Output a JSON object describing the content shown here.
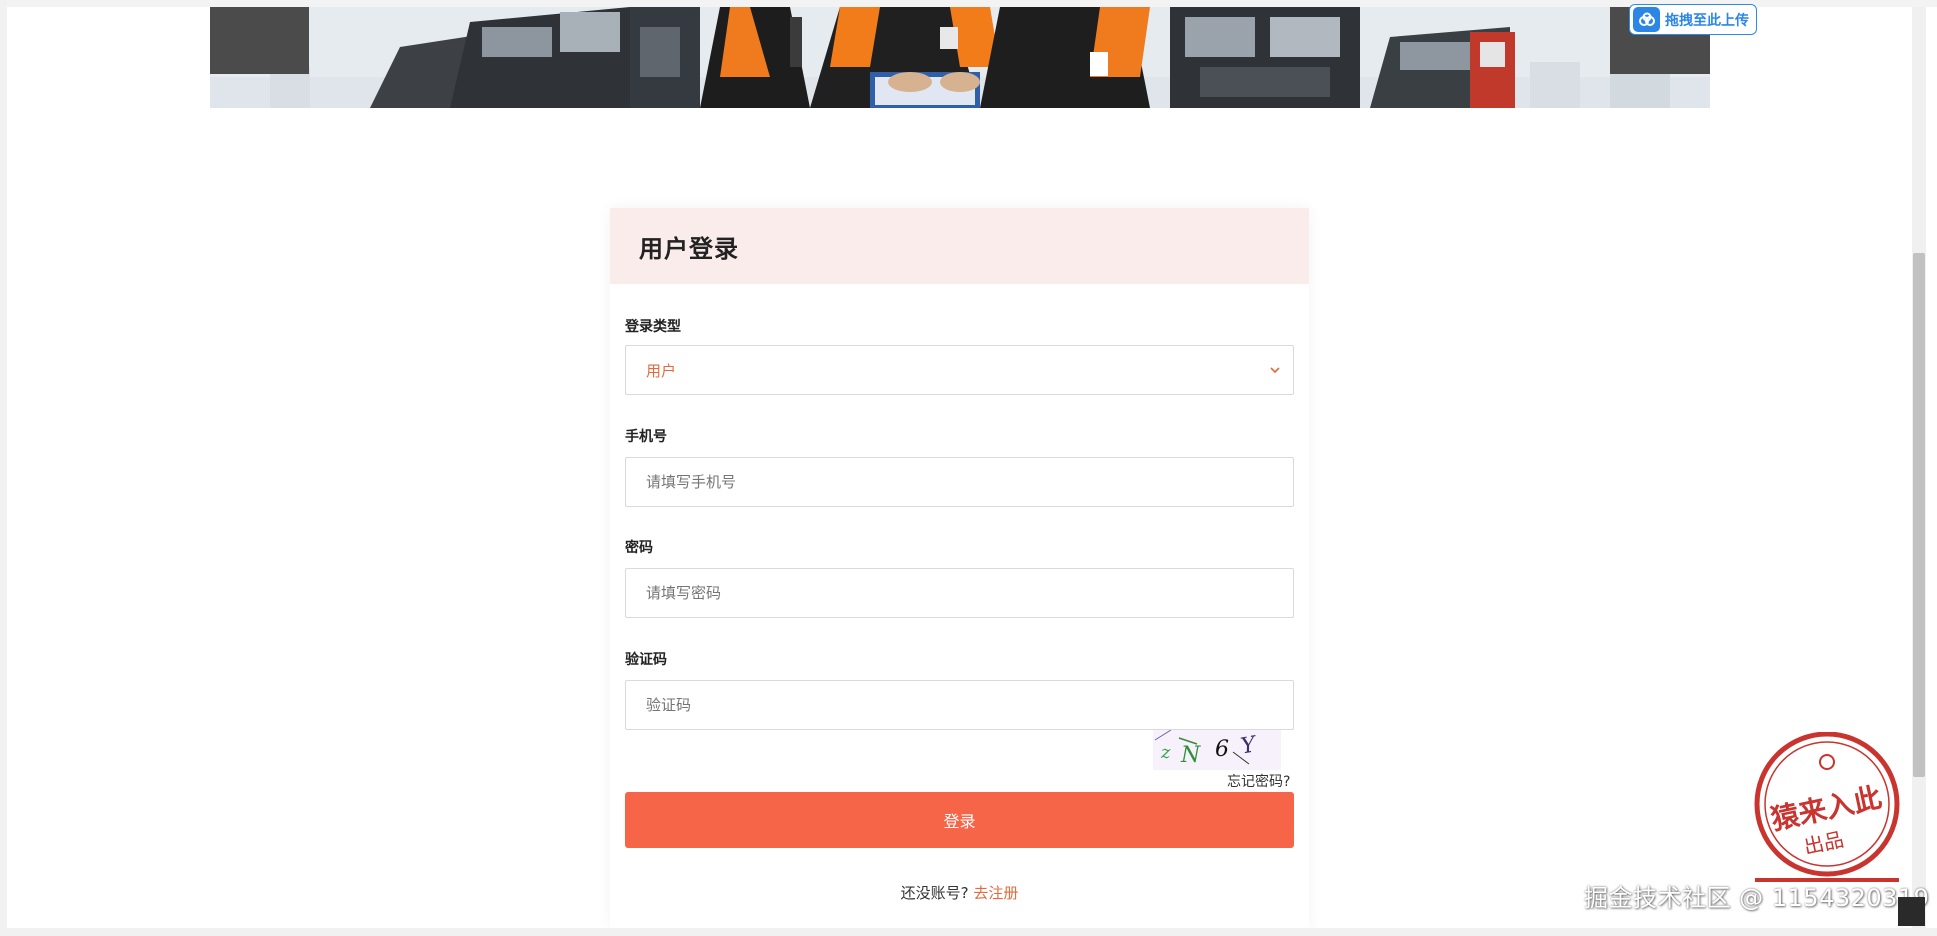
{
  "banner": {
    "upload_label": "拖拽至此上传"
  },
  "login": {
    "title": "用户登录",
    "type_label": "登录类型",
    "type_value": "用户",
    "phone_label": "手机号",
    "phone_placeholder": "请填写手机号",
    "password_label": "密码",
    "password_placeholder": "请填写密码",
    "captcha_label": "验证码",
    "captcha_placeholder": "验证码",
    "captcha_text": "zN6Y",
    "forgot_label": "忘记密码?",
    "submit_label": "登录",
    "register_prompt": "还没账号?",
    "register_link": "去注册"
  },
  "stamp": {
    "main_text": "猿来入此",
    "sub_text": "出品"
  },
  "watermark": "掘金技术社区 @ 1154320319",
  "colors": {
    "accent": "#f76548",
    "header_bg": "#f9eceb",
    "link": "#e26b3e",
    "upload_blue": "#2b86e6",
    "stamp_red": "#c9342f"
  }
}
